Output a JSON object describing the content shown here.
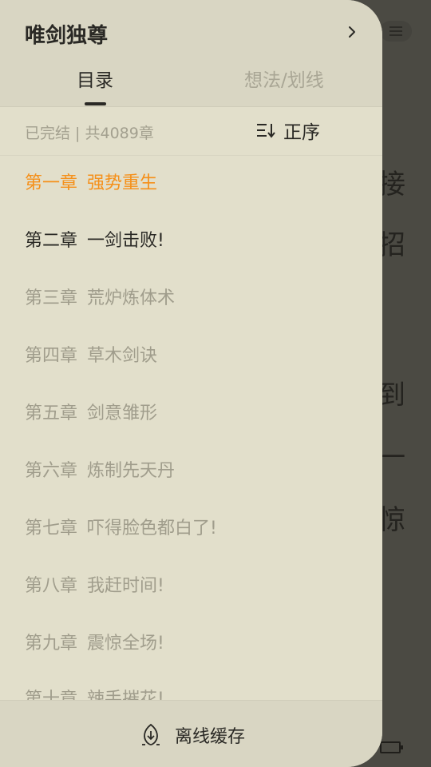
{
  "book": {
    "title": "唯剑独尊"
  },
  "tabs": [
    {
      "label": "目录",
      "active": true
    },
    {
      "label": "想法/划线",
      "active": false
    }
  ],
  "status": {
    "text": "已完结 | 共4089章"
  },
  "sort": {
    "label": "正序",
    "icon": "sort-ascending-icon"
  },
  "chapters": [
    {
      "num": "第一章",
      "title": "强势重生",
      "state": "current"
    },
    {
      "num": "第二章",
      "title": "一剑击败!",
      "state": "read"
    },
    {
      "num": "第三章",
      "title": "荒炉炼体术",
      "state": "unread"
    },
    {
      "num": "第四章",
      "title": "草木剑诀",
      "state": "unread"
    },
    {
      "num": "第五章",
      "title": "剑意雏形",
      "state": "unread"
    },
    {
      "num": "第六章",
      "title": "炼制先天丹",
      "state": "unread"
    },
    {
      "num": "第七章",
      "title": "吓得脸色都白了!",
      "state": "unread"
    },
    {
      "num": "第八章",
      "title": "我赶时间!",
      "state": "unread"
    },
    {
      "num": "第九章",
      "title": "震惊全场!",
      "state": "unread"
    },
    {
      "num": "第十章",
      "title": "辣手摧花!",
      "state": "unread"
    }
  ],
  "footer": {
    "offline_label": "离线缓存",
    "icon": "download-leaf-icon"
  },
  "background_page": {
    "chars": [
      "接",
      "招",
      "到",
      "一",
      "惊"
    ]
  },
  "colors": {
    "accent": "#f5901a",
    "drawer_bg": "#e2dfcb",
    "header_bg": "#d9d6c3",
    "text_primary": "#2a2925",
    "text_muted": "#a09d8c",
    "overlay": "#4b4a43"
  }
}
